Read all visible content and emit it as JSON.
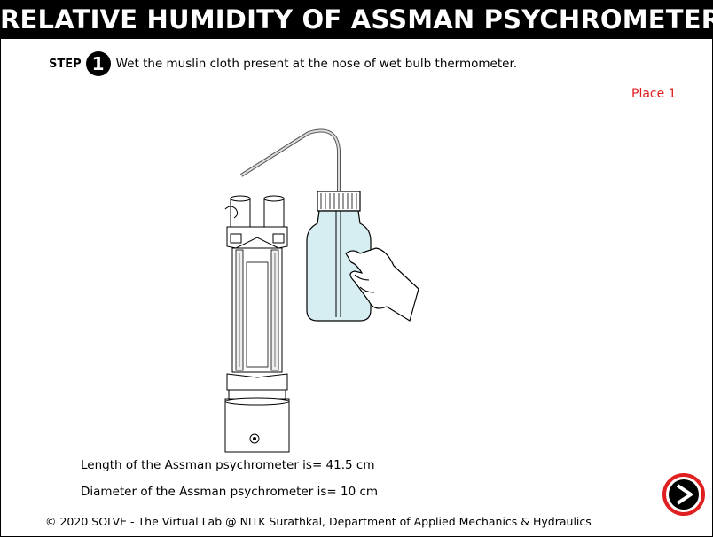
{
  "header": {
    "title": "RELATIVE HUMIDITY OF ASSMAN PSYCHROMETER"
  },
  "step": {
    "label": "STEP",
    "number": "1",
    "instruction": "Wet the muslin cloth present at the nose of wet bulb thermometer."
  },
  "place_label": "Place 1",
  "illustration": {
    "description_icons": [
      "psychrometer-icon",
      "wash-bottle-icon",
      "hand-icon"
    ],
    "bottle_fill_color": "#d6eef2"
  },
  "info": {
    "length": "Length of the Assman psychrometer is= 41.5 cm",
    "diameter": "Diameter of the Assman psychrometer is= 10 cm"
  },
  "footer": {
    "text": "© 2020 SOLVE - The Virtual Lab @ NITK Surathkal, Department of Applied Mechanics & Hydraulics"
  },
  "next_button": {
    "icon": "arrow-right-icon",
    "ring_color": "#e02020"
  }
}
